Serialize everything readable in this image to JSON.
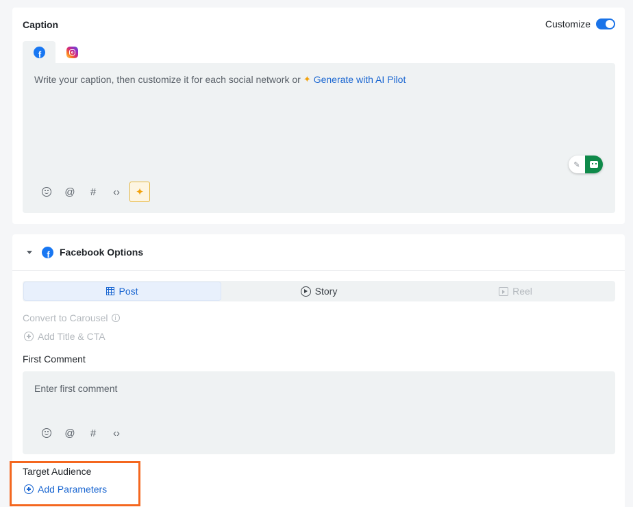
{
  "caption": {
    "title": "Caption",
    "customize_label": "Customize",
    "customize_on": true,
    "networks": [
      {
        "name": "facebook",
        "icon": "facebook-icon",
        "active": true
      },
      {
        "name": "instagram",
        "icon": "instagram-icon",
        "active": false
      }
    ],
    "placeholder": "Write your caption, then customize it for each social network or",
    "generate_link": "Generate with AI Pilot",
    "toolbar": [
      "emoji-icon",
      "mention-icon",
      "hashtag-icon",
      "code-icon",
      "ai-sparkle-icon"
    ]
  },
  "facebook_options": {
    "title": "Facebook Options",
    "post_types": [
      {
        "label": "Post",
        "icon": "grid-icon",
        "state": "active"
      },
      {
        "label": "Story",
        "icon": "play-icon",
        "state": "normal"
      },
      {
        "label": "Reel",
        "icon": "reel-icon",
        "state": "disabled"
      }
    ],
    "convert_carousel": "Convert to Carousel",
    "add_title_cta": "Add Title & CTA",
    "first_comment_label": "First Comment",
    "first_comment_placeholder": "Enter first comment",
    "target_audience_label": "Target Audience",
    "add_parameters": "Add Parameters"
  },
  "colors": {
    "accent": "#1a66d1",
    "highlight": "#f4671f",
    "ai": "#f2a20c"
  }
}
